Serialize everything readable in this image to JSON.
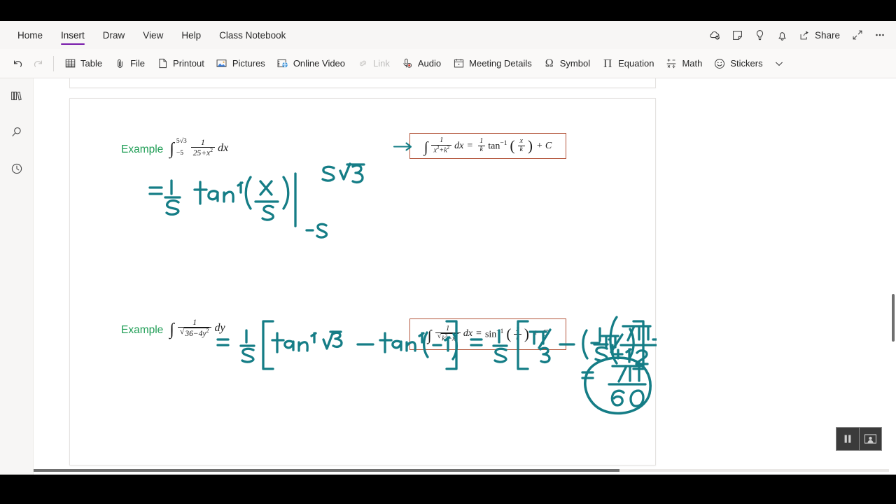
{
  "app": {
    "name": "OneNote",
    "accent_color": "#7719aa",
    "formula_box_border": "#b3543a",
    "ink_color": "#157d86",
    "example_label_color": "#1f9d55"
  },
  "ribbon_tabs": [
    {
      "label": "Home",
      "active": false
    },
    {
      "label": "Insert",
      "active": true
    },
    {
      "label": "Draw",
      "active": false
    },
    {
      "label": "View",
      "active": false
    },
    {
      "label": "Help",
      "active": false
    },
    {
      "label": "Class Notebook",
      "active": false
    }
  ],
  "title_bar_right": {
    "icons": [
      {
        "name": "cloud-saved-icon",
        "title": "Saved"
      },
      {
        "name": "sticky-note-icon",
        "title": "Notes"
      },
      {
        "name": "lightbulb-icon",
        "title": "Tell me"
      },
      {
        "name": "bell-icon",
        "title": "Notifications"
      }
    ],
    "share_label": "Share",
    "expand_icon": "expand-icon",
    "more_icon": "ellipsis-icon"
  },
  "ribbon_commands": [
    {
      "label": "",
      "icon": "undo-icon",
      "icon_only": true,
      "disabled": false
    },
    {
      "label": "",
      "icon": "redo-icon",
      "icon_only": true,
      "disabled": true
    },
    {
      "label": "Table",
      "icon": "table-icon",
      "disabled": false
    },
    {
      "label": "File",
      "icon": "paperclip-icon",
      "disabled": false
    },
    {
      "label": "Printout",
      "icon": "page-icon",
      "disabled": false
    },
    {
      "label": "Pictures",
      "icon": "picture-icon",
      "disabled": false
    },
    {
      "label": "Online Video",
      "icon": "online-video-icon",
      "disabled": false
    },
    {
      "label": "Link",
      "icon": "link-icon",
      "disabled": true
    },
    {
      "label": "Audio",
      "icon": "audio-icon",
      "disabled": false
    },
    {
      "label": "Meeting Details",
      "icon": "calendar-icon",
      "disabled": false
    },
    {
      "label": "Symbol",
      "icon": "omega-icon",
      "disabled": false
    },
    {
      "label": "Equation",
      "icon": "pi-icon",
      "disabled": false
    },
    {
      "label": "Math",
      "icon": "math-icon",
      "disabled": false
    },
    {
      "label": "Stickers",
      "icon": "smiley-icon",
      "disabled": false
    },
    {
      "label": "",
      "icon": "chevron-down-icon",
      "icon_only": true,
      "disabled": false
    }
  ],
  "left_rail": [
    {
      "name": "notebooks-icon",
      "label": "Notebooks"
    },
    {
      "name": "search-icon",
      "label": "Search"
    },
    {
      "name": "recent-icon",
      "label": "Recent"
    }
  ],
  "page_content": {
    "example_1": {
      "label": "Example",
      "integral": {
        "lower_limit": "−5",
        "upper_limit": "5√3",
        "numerator": "1",
        "denominator": "25+x²",
        "differential": "dx"
      }
    },
    "example_2": {
      "label": "Example",
      "integral": {
        "lower_limit": "",
        "upper_limit": "",
        "numerator": "1",
        "denominator": "√(36−4y²)",
        "differential": "dy"
      }
    },
    "formula_box_1": {
      "text": "∫ 1/(x²+k²) dx = (1/k) tan⁻¹(x/k) + C",
      "lhs_numerator": "1",
      "lhs_denominator": "x²+k²",
      "differential": "dx",
      "rhs_coeff_num": "1",
      "rhs_coeff_den": "k",
      "rhs_function": "tan",
      "rhs_exponent": "−1",
      "rhs_arg_num": "x",
      "rhs_arg_den": "k",
      "constant": "+ C"
    },
    "formula_box_2": {
      "text": "∫ 1/√(k²−x²) dx = sin⁻¹(x/k) + C",
      "lhs_numerator": "1",
      "lhs_denominator": "√(k²−x²)",
      "differential": "dx",
      "rhs_function": "sin",
      "rhs_exponent": "−1",
      "rhs_arg_num": "x",
      "rhs_arg_den": "k",
      "constant": "+ C"
    },
    "handwriting": {
      "line_1": "= 1/5 tan⁻¹(x/5) |₋₅^{5√3}",
      "line_2_left": "= 1/5 [ tan⁻¹√3 − tan⁻¹(−1) ]",
      "line_2_mid": "= 1/5 [ π/3 − (−π/4) ]",
      "line_2_right": "= 1/5 ( 7π/12 )",
      "final_answer": "= 7π/60"
    }
  },
  "video_overlay": {
    "pause_button": "pause-icon",
    "presenter_button": "presenter-view-icon"
  },
  "scroll": {
    "horizontal_progress_percent": 68.5
  }
}
